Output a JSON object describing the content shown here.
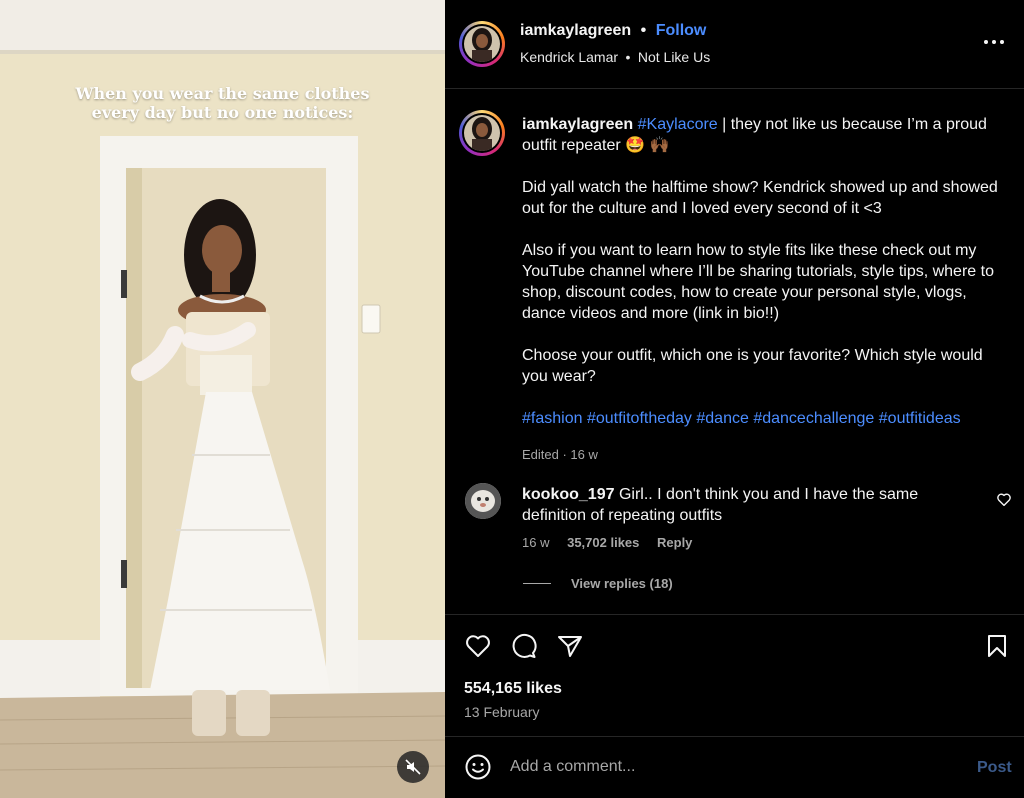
{
  "media": {
    "overlay_caption_line1": "When you wear the same clothes",
    "overlay_caption_line2": "every day but no one notices:",
    "mute_icon": "speaker-muted-icon"
  },
  "header": {
    "username": "iamkaylagreen",
    "separator": "•",
    "follow_label": "Follow",
    "artist": "Kendrick Lamar",
    "song_separator": "•",
    "song": "Not Like Us",
    "more_icon": "more-horizontal-icon"
  },
  "caption": {
    "username": "iamkaylagreen",
    "hashtag": "#Kaylacore",
    "first_text": " | they not like us because I’m a proud outfit repeater 🤩 🙌🏾",
    "paragraph2": "Did yall watch the halftime show? Kendrick showed up and showed out for the culture and I loved every second of it <3",
    "paragraph3": "Also if you want to learn how to style fits like these check out my YouTube channel where I’ll be sharing tutorials, style tips, where to shop, discount codes, how to create your personal style, vlogs, dance videos and more (link in bio!!)",
    "paragraph4": "Choose your outfit, which one is your favorite? Which style would you wear?",
    "hashtags": [
      "#fashion",
      "#outfitoftheday",
      "#dance",
      "#dancechallenge",
      "#outfitideas"
    ],
    "edited": "Edited · 16 w"
  },
  "comment": {
    "username": "kookoo_197",
    "text": "Girl.. I don't think you and I have the same definition of repeating outfits",
    "age": "16 w",
    "likes": "35,702 likes",
    "reply_label": "Reply",
    "view_replies": "View replies (18)"
  },
  "actions": {
    "like_icon": "heart-icon",
    "comment_icon": "comment-icon",
    "share_icon": "paper-plane-icon",
    "save_icon": "bookmark-icon"
  },
  "stats": {
    "likes": "554,165 likes",
    "date": "13 February"
  },
  "composer": {
    "emoji_icon": "smiley-icon",
    "placeholder": "Add a comment...",
    "post_label": "Post"
  },
  "colors": {
    "background": "#000000",
    "text_primary": "#f5f5f5",
    "text_secondary": "#a8a8a8",
    "link_blue": "#4c8dff",
    "divider": "#262626"
  }
}
